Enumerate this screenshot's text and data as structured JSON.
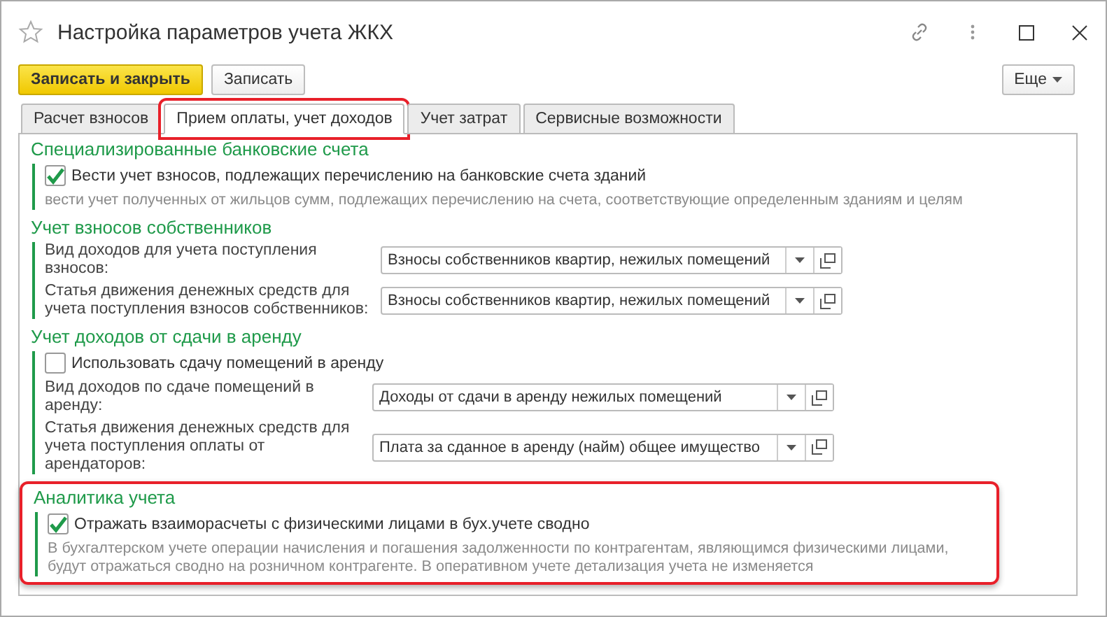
{
  "window": {
    "title": "Настройка параметров учета ЖКХ"
  },
  "toolbar": {
    "buttons": [
      {
        "label": "Записать и закрыть",
        "kind": "primary"
      },
      {
        "label": "Записать",
        "kind": "default"
      }
    ],
    "more": "Еще"
  },
  "tabs": [
    {
      "label": "Расчет взносов",
      "selected": false,
      "highlighted": false
    },
    {
      "label": "Прием оплаты, учет доходов",
      "selected": true,
      "highlighted": true
    },
    {
      "label": "Учет затрат",
      "selected": false,
      "highlighted": false
    },
    {
      "label": "Сервисные возможности",
      "selected": false,
      "highlighted": false
    }
  ],
  "sections": [
    {
      "title": "Специализированные банковские счета",
      "highlighted": false,
      "items": [
        {
          "kind": "checkbox",
          "label": "Вести учет взносов, подлежащих перечислению на банковские счета зданий",
          "checked": true
        },
        {
          "kind": "hint",
          "text": "вести учет полученных от жильцов сумм, подлежащих перечислению на счета, соответствующие определенным зданиям и целям"
        }
      ]
    },
    {
      "title": "Учет взносов собственников",
      "highlighted": false,
      "items": [
        {
          "kind": "field",
          "label": "Вид доходов для учета поступления взносов:",
          "value": "Взносы собственников квартир, нежилых помещений"
        },
        {
          "kind": "field",
          "label": "Статья движения денежных средств для учета поступления взносов собственников:",
          "value": "Взносы собственников квартир, нежилых помещений"
        }
      ]
    },
    {
      "title": "Учет доходов от сдачи в аренду",
      "highlighted": false,
      "items": [
        {
          "kind": "checkbox",
          "label": "Использовать сдачу помещений в аренду",
          "checked": false
        },
        {
          "kind": "field",
          "label": "Вид доходов по сдаче помещений в аренду:",
          "value": "Доходы от сдачи в аренду нежилых помещений"
        },
        {
          "kind": "field",
          "label": "Статья движения денежных средств для учета поступления оплаты от арендаторов:",
          "value": "Плата за сданное в аренду (найм) общее имущество"
        }
      ]
    },
    {
      "title": "Аналитика учета",
      "highlighted": true,
      "items": [
        {
          "kind": "checkbox",
          "label": "Отражать взаиморасчеты с физическими лицами в бух.учете сводно",
          "checked": true
        },
        {
          "kind": "hint",
          "text": "В бухгалтерском учете операции начисления и погашения задолженности по контрагентам, являющимся физическими лицами, будут отражаться сводно на розничном контрагенте. В оперативном учете детализация учета не изменяется"
        }
      ]
    }
  ]
}
